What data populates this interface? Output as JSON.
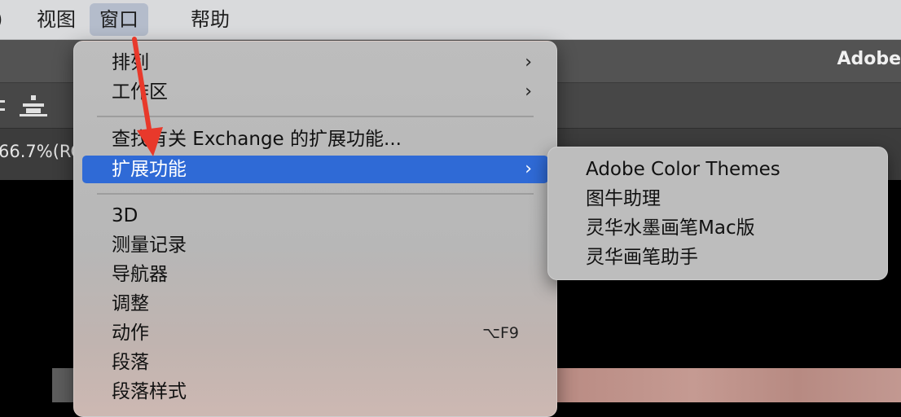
{
  "menubar": {
    "edge_glyph": ")",
    "items": [
      {
        "label": "视图"
      },
      {
        "label": "窗口"
      },
      {
        "label": "帮助"
      }
    ]
  },
  "app": {
    "brand_partial": "Adobe",
    "doc_tab_partial": "66.7%(RC"
  },
  "window_menu": {
    "items": [
      {
        "label": "排列",
        "submenu": true
      },
      {
        "label": "工作区",
        "submenu": true
      },
      {
        "label": "查找有关 Exchange 的扩展功能..."
      },
      {
        "label": "扩展功能",
        "submenu": true,
        "highlighted": true
      },
      {
        "label": "3D"
      },
      {
        "label": "测量记录"
      },
      {
        "label": "导航器"
      },
      {
        "label": "调整"
      },
      {
        "label": "动作",
        "shortcut": "⌥F9"
      },
      {
        "label": "段落"
      },
      {
        "label": "段落样式"
      }
    ]
  },
  "extensions_submenu": {
    "items": [
      {
        "label": "Adobe Color Themes"
      },
      {
        "label": "图牛助理"
      },
      {
        "label": "灵华水墨画笔Mac版"
      },
      {
        "label": "灵华画笔助手"
      }
    ]
  },
  "colors": {
    "highlight": "#2f6ad6",
    "annotation_arrow": "#e8392b"
  }
}
